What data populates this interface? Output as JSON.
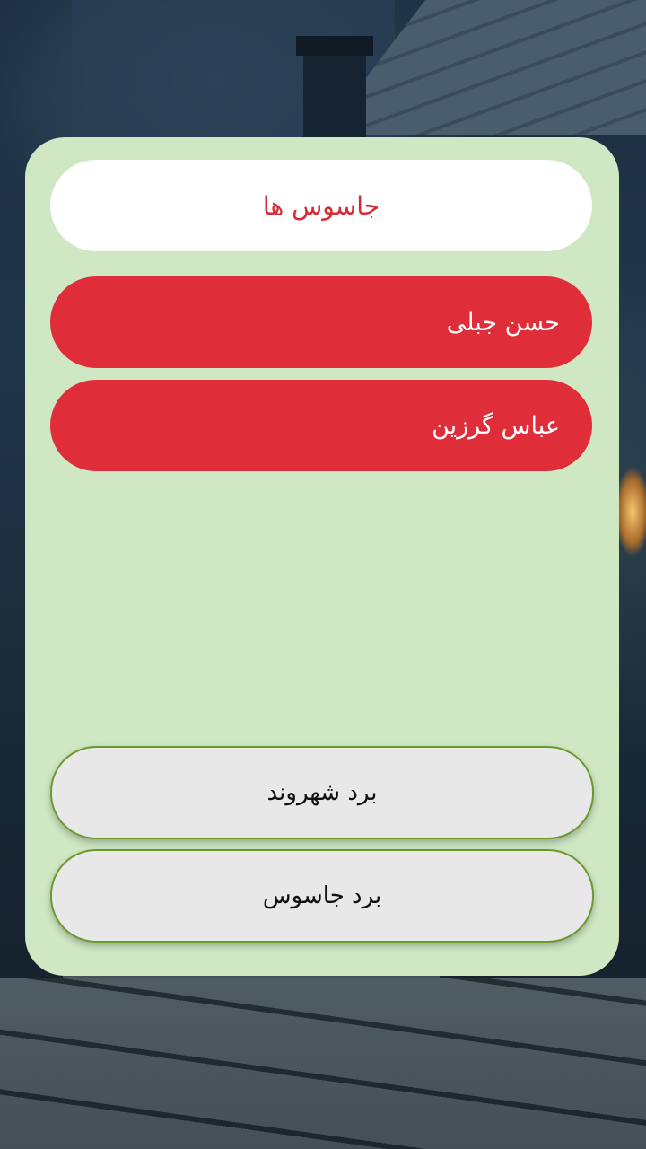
{
  "header": {
    "title": "جاسوس ها",
    "title_color": "#d42c33"
  },
  "players": [
    {
      "name": "حسن جبلی"
    },
    {
      "name": "عباس گرزین"
    }
  ],
  "actions": {
    "citizen_win_label": "برد شهروند",
    "spy_win_label": "برد جاسوس"
  },
  "colors": {
    "card_background": "#cfe7c3",
    "player_item": "#df2d3a",
    "button_background": "#e8e8e8",
    "button_border": "#6a9a2c"
  }
}
